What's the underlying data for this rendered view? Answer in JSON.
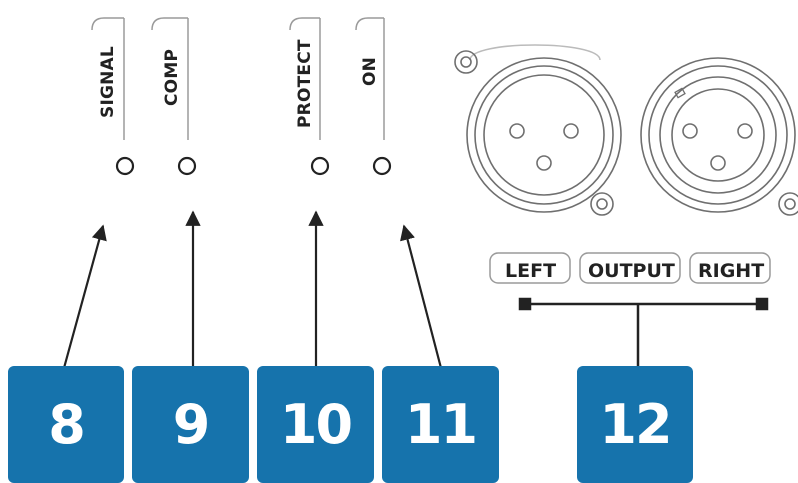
{
  "labels": {
    "signal": "SIGNAL",
    "comp": "COMP",
    "protect": "PROTECT",
    "on": "ON",
    "left": "LEFT",
    "output": "OUTPUT",
    "right": "RIGHT"
  },
  "callouts": [
    "8",
    "9",
    "10",
    "11",
    "12"
  ],
  "colors": {
    "callout_fill": "#1673ac",
    "callout_text": "#ffffff",
    "line": "#222222",
    "connector_stroke": "#7a7a7a"
  }
}
